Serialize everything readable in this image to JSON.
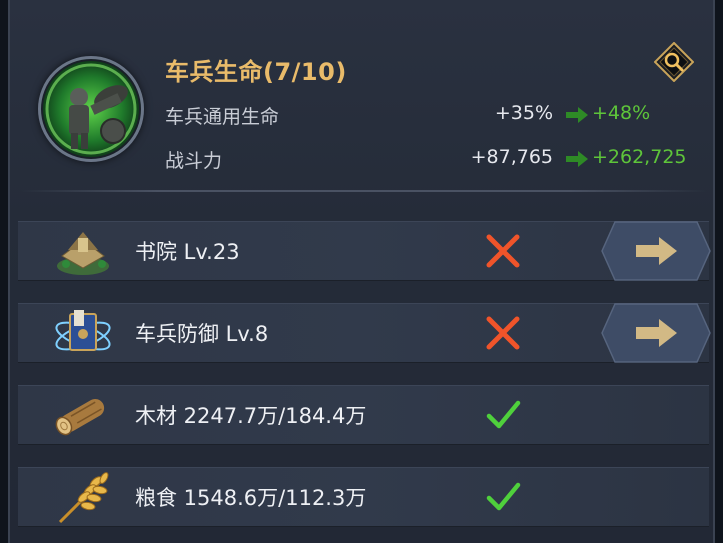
{
  "header": {
    "title": "车兵生命(7/10)",
    "portrait_icon": "chariot-soldier-icon",
    "stats": [
      {
        "label": "车兵通用生命",
        "current": "+35%",
        "next": "+48%"
      },
      {
        "label": "战斗力",
        "current": "+87,765",
        "next": "+262,725"
      }
    ],
    "search_icon": "magnifier-icon"
  },
  "requirements": [
    {
      "icon": "academy-icon",
      "text": "书院 Lv.23",
      "status": "unmet",
      "has_go_button": true
    },
    {
      "icon": "chariot-defense-book-icon",
      "text": "车兵防御 Lv.8",
      "status": "unmet",
      "has_go_button": true
    },
    {
      "icon": "wood-log-icon",
      "text": "木材 2247.7万/184.4万",
      "status": "met",
      "has_go_button": false
    },
    {
      "icon": "grain-wheat-icon",
      "text": "粮食 1548.6万/112.3万",
      "status": "met",
      "has_go_button": false
    }
  ],
  "colors": {
    "title_gold": "#e9bb6a",
    "upgrade_green": "#5ec53a",
    "unmet_red": "#f0542a",
    "met_green": "#4fd03c",
    "button_blue": "#3e4c66"
  }
}
